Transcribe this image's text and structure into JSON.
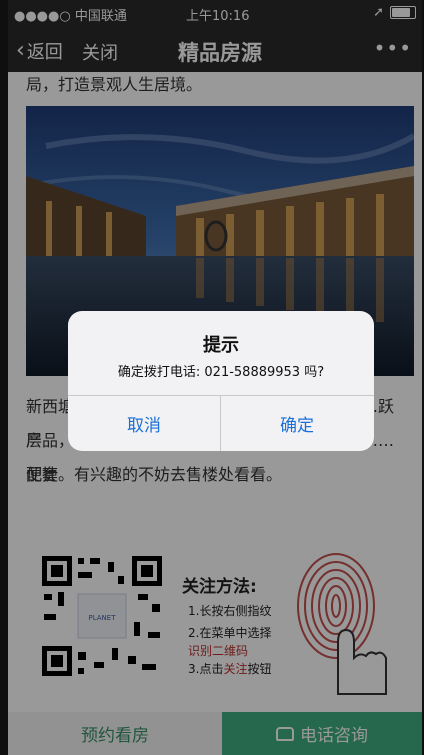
{
  "status_bar": {
    "carrier": "●●●●○ 中国联通",
    "time": "上午10:16"
  },
  "nav": {
    "back_label": "返回",
    "close_label": "关闭",
    "title": "精品房源",
    "more_label": "•••"
  },
  "article": {
    "intro_tail": "局，打造景观人生居境。",
    "para_line1": "新西塘…………………………………………………跃层",
    "para_line2": "产品，……………………………………………………便捷",
    "para_line3": "配套。有兴趣的不妨去售楼处看看。"
  },
  "follow": {
    "title": "关注方法:",
    "step1": "1.长按右侧指纹",
    "step2": "2.在菜单中选择",
    "step2b": "识别二维码",
    "step3_prefix": "3.点击",
    "step3_highlight": "关注",
    "step3_suffix": "按钮",
    "qr_logo_text": "PLANET"
  },
  "bottom_bar": {
    "book_label": "预约看房",
    "call_label": "电话咨询"
  },
  "dialog": {
    "title": "提示",
    "message": "确定拨打电话: 021-58889953 吗?",
    "cancel_label": "取消",
    "confirm_label": "确定"
  },
  "colors": {
    "navbar": "#2b2b2b",
    "accent_green": "#3fae81",
    "dialog_button": "#1a6fd8"
  }
}
